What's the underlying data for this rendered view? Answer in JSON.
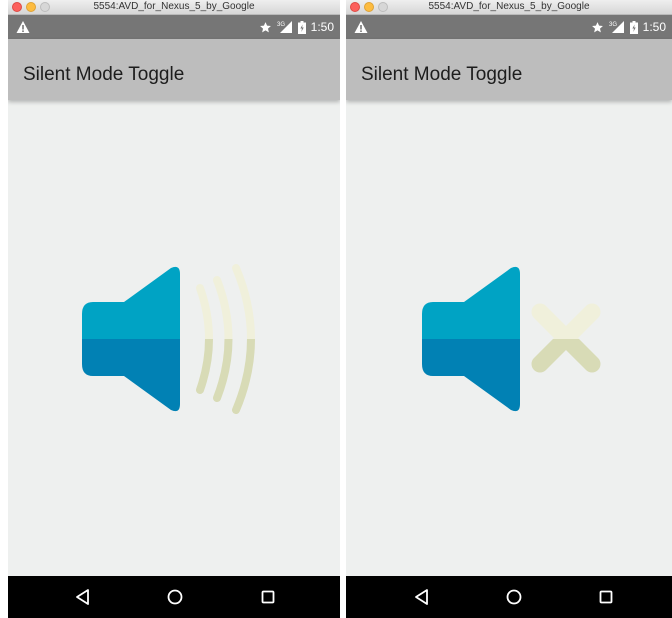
{
  "emulators": [
    {
      "window_title": "5554:AVD_for_Nexus_5_by_Google",
      "status": {
        "time": "1:50",
        "network": "3G"
      },
      "app_title": "Silent Mode Toggle",
      "mode": "ringer-on",
      "icon": "speaker-sound-icon"
    },
    {
      "window_title": "5554:AVD_for_Nexus_5_by_Google",
      "status": {
        "time": "1:50",
        "network": "3G"
      },
      "app_title": "Silent Mode Toggle",
      "mode": "silent",
      "icon": "speaker-muted-icon"
    }
  ],
  "colors": {
    "speaker_top": "#00a3c4",
    "speaker_bottom": "#0181b4",
    "wave_light": "#f0f0db",
    "wave_dark": "#d8dbb6",
    "status_bar": "#767676",
    "action_bar": "#bdbdbd",
    "content_bg": "#eef0ef",
    "nav_bar": "#000000"
  }
}
